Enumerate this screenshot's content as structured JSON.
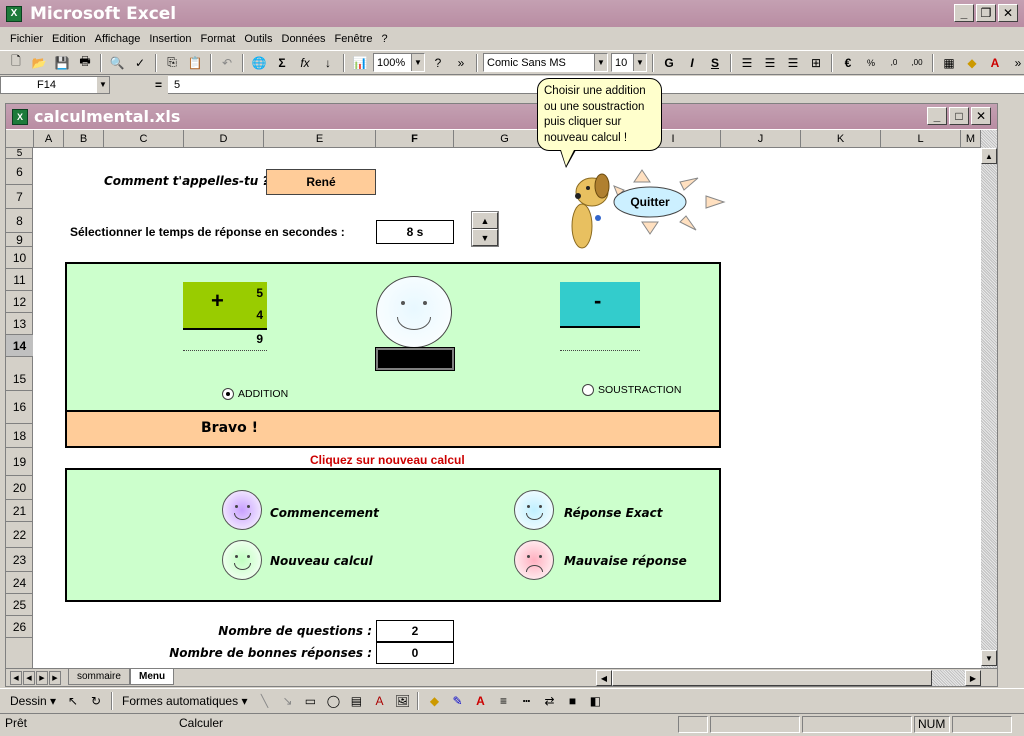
{
  "app": {
    "title": "Microsoft Excel",
    "icon": "excel-icon"
  },
  "menu": [
    "Fichier",
    "Edition",
    "Affichage",
    "Insertion",
    "Format",
    "Outils",
    "Données",
    "Fenêtre",
    "?"
  ],
  "toolbar": {
    "zoom": "100%",
    "font": "Comic Sans MS",
    "size": "10",
    "bold": "G",
    "italic": "I",
    "underline": "S"
  },
  "formula": {
    "cell": "F14",
    "eq": "=",
    "value": "5"
  },
  "workbook": {
    "title": "calculmental.xls"
  },
  "columns": [
    "A",
    "B",
    "C",
    "D",
    "E",
    "F",
    "G",
    "H",
    "I",
    "J",
    "K",
    "L",
    "M"
  ],
  "rows": [
    "5",
    "6",
    "7",
    "8",
    "9",
    "10",
    "11",
    "12",
    "13",
    "14",
    "15",
    "16",
    "18",
    "19",
    "20",
    "21",
    "22",
    "23",
    "24",
    "25",
    "26"
  ],
  "sheet": {
    "name_label": "Comment t'appelles-tu ?",
    "name_value": "René",
    "time_label": "Sélectionner le temps de réponse en secondes :",
    "time_value": "8 s",
    "add_sign": "+",
    "add_n1": "5",
    "add_n2": "4",
    "add_result": "9",
    "sub_sign": "-",
    "radio_add": "ADDITION",
    "radio_sub": "SOUSTRACTION",
    "message": "Bravo !",
    "hint": "Cliquez sur nouveau calcul",
    "legend": {
      "start": "Commencement",
      "exact": "Réponse Exact",
      "new": "Nouveau calcul",
      "wrong": "Mauvaise réponse"
    },
    "q_label": "Nombre de questions :",
    "q_value": "2",
    "good_label": "Nombre de bonnes réponses :",
    "good_value": "0",
    "quit": "Quitter",
    "bubble": "Choisir une addition ou une soustraction puis cliquer sur nouveau calcul !"
  },
  "tabs": [
    "sommaire",
    "Menu"
  ],
  "drawing": {
    "dessin": "Dessin",
    "formes": "Formes automatiques"
  },
  "status": {
    "ready": "Prêt",
    "calc": "Calculer",
    "num": "NUM"
  },
  "colors": {
    "title": "#b98da3",
    "panel": "#ccffcc",
    "orange": "#ffcc99",
    "green": "#99cc00",
    "teal": "#33cccc",
    "hint": "#cc0000"
  }
}
